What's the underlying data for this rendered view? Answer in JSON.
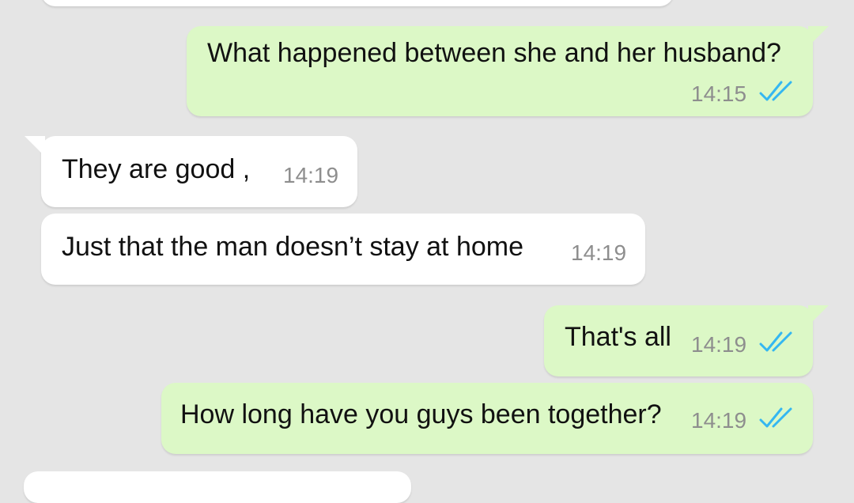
{
  "conversation": {
    "messages": [
      {
        "direction": "outgoing",
        "text": "What happened between she and her husband?",
        "time": "14:15",
        "status": "read"
      },
      {
        "direction": "incoming",
        "text": "They are good ,",
        "time": "14:19"
      },
      {
        "direction": "incoming",
        "text": "Just that the man doesn’t stay at home",
        "time": "14:19"
      },
      {
        "direction": "outgoing",
        "text": "That's all",
        "time": "14:19",
        "status": "read"
      },
      {
        "direction": "outgoing",
        "text": "How long have you guys been together?",
        "time": "14:19",
        "status": "read"
      }
    ]
  },
  "colors": {
    "background": "#e5e5e5",
    "incoming_bubble": "#ffffff",
    "outgoing_bubble": "#dcf8c6",
    "read_ticks": "#34b7f1",
    "timestamp": "#8e8e8e"
  },
  "icons": {
    "read_receipt": "double-check-icon"
  }
}
